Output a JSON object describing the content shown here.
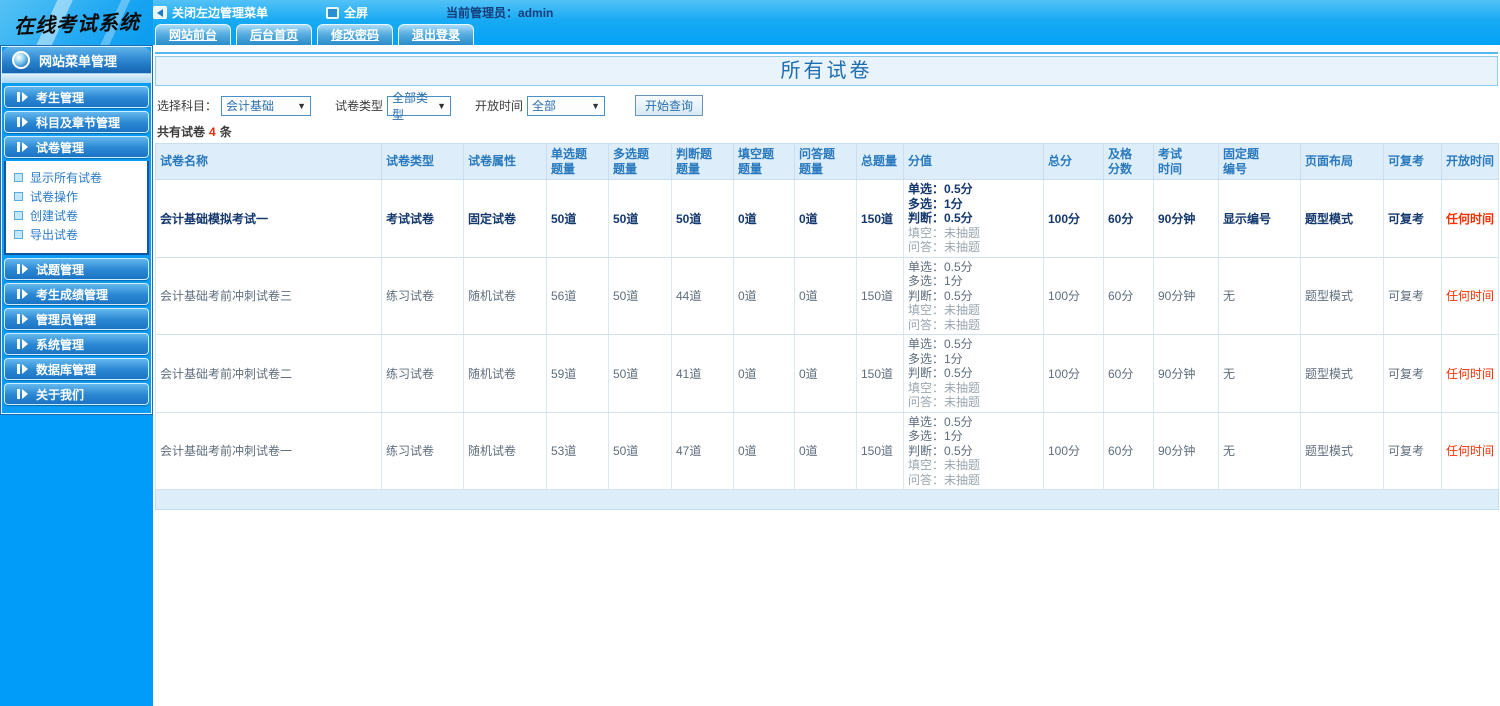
{
  "logo": {
    "title": "在线考试系统"
  },
  "topbar": {
    "close_menu_label": "关闭左边管理菜单",
    "fullscreen_label": "全屏",
    "admin_label": "当前管理员：admin",
    "tabs": [
      {
        "label": "网站前台"
      },
      {
        "label": "后台首页"
      },
      {
        "label": "修改密码"
      },
      {
        "label": "退出登录"
      }
    ]
  },
  "sidebar": {
    "header": "网站菜单管理",
    "groups": [
      {
        "label": "考生管理"
      },
      {
        "label": "科目及章节管理"
      },
      {
        "label": "试卷管理",
        "items": [
          {
            "label": "显示所有试卷"
          },
          {
            "label": "试卷操作"
          },
          {
            "label": "创建试卷"
          },
          {
            "label": "导出试卷"
          }
        ]
      },
      {
        "label": "试题管理"
      },
      {
        "label": "考生成绩管理"
      },
      {
        "label": "管理员管理"
      },
      {
        "label": "系统管理"
      },
      {
        "label": "数据库管理"
      },
      {
        "label": "关于我们"
      }
    ]
  },
  "main": {
    "title": "所有试卷",
    "filters": {
      "subject_label": "选择科目：",
      "subject_value": "会计基础",
      "type_label": "试卷类型",
      "type_value": "全部类型",
      "time_label": "开放时间",
      "time_value": "全部",
      "search_button": "开始查询"
    },
    "count": {
      "prefix": "共有试卷",
      "value": "4",
      "suffix": "条"
    },
    "table": {
      "headers": {
        "name": "试卷名称",
        "type": "试卷类型",
        "attr": "试卷属性",
        "single": "单选题\n题量",
        "multi": "多选题\n题量",
        "judge": "判断题\n题量",
        "blank": "填空题\n题量",
        "qa": "问答题\n题量",
        "total": "总题量",
        "score": "分值",
        "total_score": "总分",
        "pass_score": "及格\n分数",
        "exam_time": "考试\n时间",
        "fixed_no": "固定题\n编号",
        "layout": "页面布局",
        "retake": "可复考",
        "open_time": "开放时间"
      },
      "rows": [
        {
          "name": "会计基础模拟考试一",
          "type": "考试试卷",
          "attr": "固定试卷",
          "single": "50道",
          "multi": "50道",
          "judge": "50道",
          "blank": "0道",
          "qa": "0道",
          "total": "150道",
          "scores": [
            "单选：0.5分",
            "多选：1分",
            "判断：0.5分",
            "填空：未抽题",
            "问答：未抽题"
          ],
          "total_score": "100分",
          "pass_score": "60分",
          "exam_time": "90分钟",
          "fixed_no": "显示编号",
          "layout": "题型模式",
          "retake": "可复考",
          "open_time": "任何时间"
        },
        {
          "name": "会计基础考前冲刺试卷三",
          "type": "练习试卷",
          "attr": "随机试卷",
          "single": "56道",
          "multi": "50道",
          "judge": "44道",
          "blank": "0道",
          "qa": "0道",
          "total": "150道",
          "scores": [
            "单选：0.5分",
            "多选：1分",
            "判断：0.5分",
            "填空：未抽题",
            "问答：未抽题"
          ],
          "total_score": "100分",
          "pass_score": "60分",
          "exam_time": "90分钟",
          "fixed_no": "无",
          "layout": "题型模式",
          "retake": "可复考",
          "open_time": "任何时间"
        },
        {
          "name": "会计基础考前冲刺试卷二",
          "type": "练习试卷",
          "attr": "随机试卷",
          "single": "59道",
          "multi": "50道",
          "judge": "41道",
          "blank": "0道",
          "qa": "0道",
          "total": "150道",
          "scores": [
            "单选：0.5分",
            "多选：1分",
            "判断：0.5分",
            "填空：未抽题",
            "问答：未抽题"
          ],
          "total_score": "100分",
          "pass_score": "60分",
          "exam_time": "90分钟",
          "fixed_no": "无",
          "layout": "题型模式",
          "retake": "可复考",
          "open_time": "任何时间"
        },
        {
          "name": "会计基础考前冲刺试卷一",
          "type": "练习试卷",
          "attr": "随机试卷",
          "single": "53道",
          "multi": "50道",
          "judge": "47道",
          "blank": "0道",
          "qa": "0道",
          "total": "150道",
          "scores": [
            "单选：0.5分",
            "多选：1分",
            "判断：0.5分",
            "填空：未抽题",
            "问答：未抽题"
          ],
          "total_score": "100分",
          "pass_score": "60分",
          "exam_time": "90分钟",
          "fixed_no": "无",
          "layout": "题型模式",
          "retake": "可复考",
          "open_time": "任何时间"
        }
      ]
    }
  },
  "icons": {
    "collapse": "left-triangle",
    "fullscreen": "screen-box",
    "dropdown": "▼"
  },
  "colors": {
    "topbar_blue": "#0aa2f2",
    "sidebar_blue": "#019bf9",
    "header_text_blue": "#2a79be",
    "row_text_gray": "#5f6e7d",
    "emphasis_navy": "#14386e",
    "alert_red": "#f52f00",
    "muted_gray": "#9aa6b0",
    "table_header_bg": "#ddeefa"
  }
}
